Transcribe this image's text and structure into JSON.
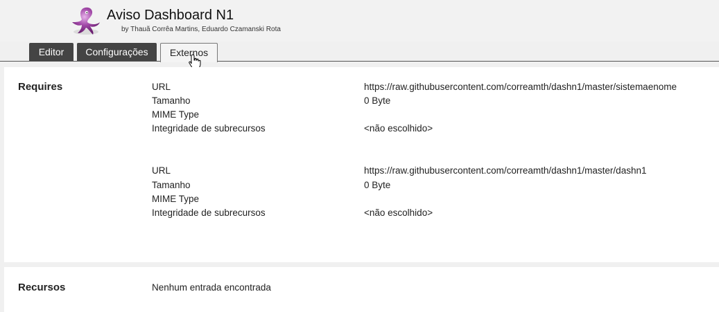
{
  "app": {
    "title": "Aviso Dashboard N1",
    "author": "by Thauã Corrêa Martins, Eduardo Czamanski Rota"
  },
  "tabs": [
    {
      "label": "Editor"
    },
    {
      "label": "Configurações"
    },
    {
      "label": "Externos"
    }
  ],
  "requires": {
    "title": "Requires",
    "entries": [
      {
        "url_label": "URL",
        "url": "https://raw.githubusercontent.com/correamth/dashn1/master/sistemaenome",
        "size_label": "Tamanho",
        "size": "0 Byte",
        "mime_label": "MIME Type",
        "mime": "",
        "integrity_label": "Integridade de subrecursos",
        "integrity": "<não escolhido>"
      },
      {
        "url_label": "URL",
        "url": "https://raw.githubusercontent.com/correamth/dashn1/master/dashn1",
        "size_label": "Tamanho",
        "size": "0 Byte",
        "mime_label": "MIME Type",
        "mime": "",
        "integrity_label": "Integridade de subrecursos",
        "integrity": "<não escolhido>"
      }
    ]
  },
  "resources": {
    "title": "Recursos",
    "empty_text": "Nenhum entrada encontrada"
  },
  "colors": {
    "logo": "#9b3fa0",
    "tab_inactive": "#444444"
  },
  "icons": {
    "logo": "octopus-logo-icon",
    "cursor": "hand-pointer-icon"
  }
}
